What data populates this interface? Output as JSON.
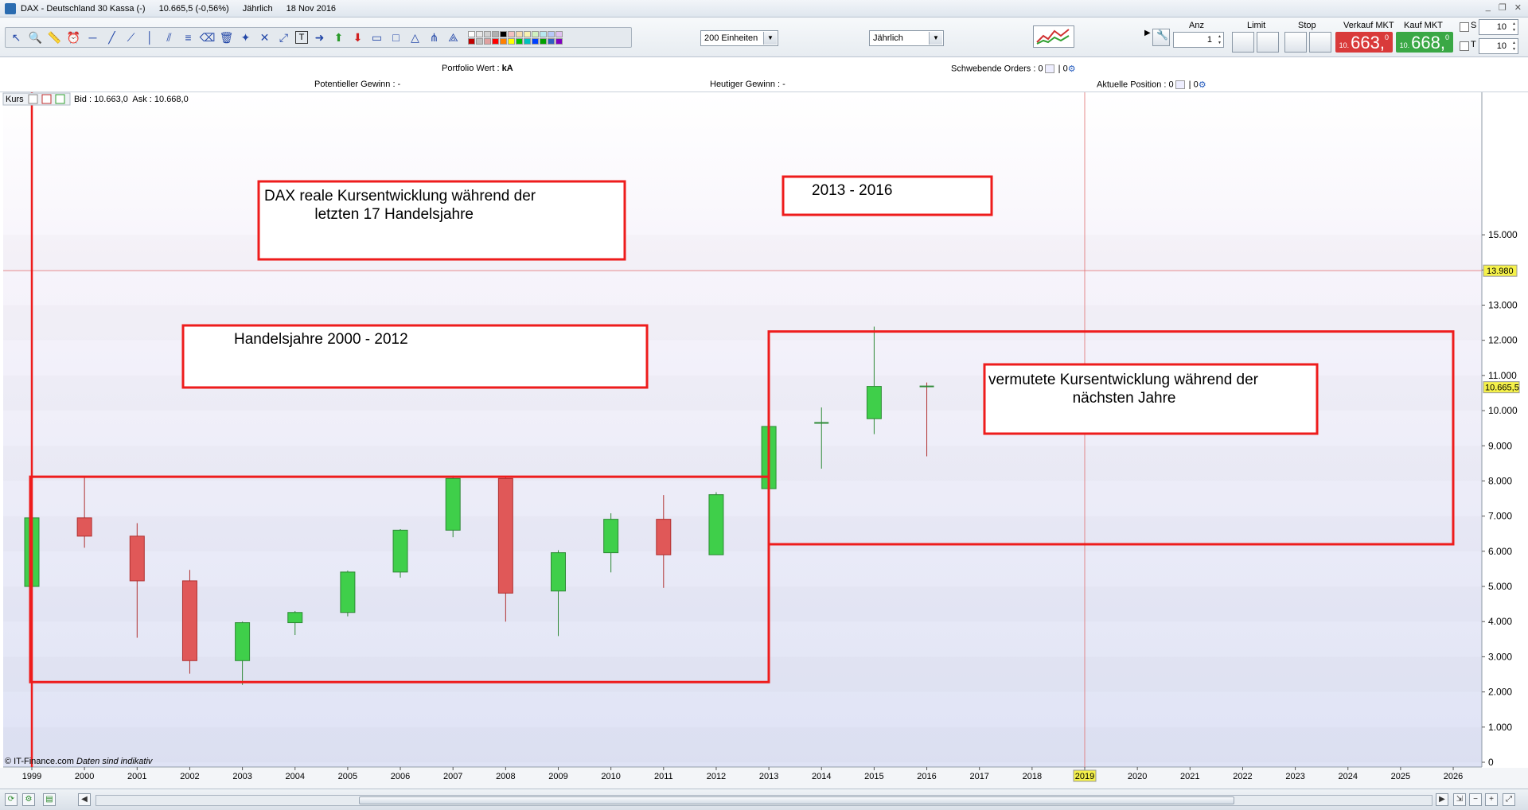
{
  "window": {
    "instrument": "DAX - Deutschland 30 Kassa (-)",
    "quote": "10.665,5 (-0,56%)",
    "period": "Jährlich",
    "date": "18 Nov 2016"
  },
  "toolbar": {
    "units_select": "200 Einheiten",
    "interval_select": "Jährlich",
    "tool_icons": [
      "cursor-icon",
      "zoom-icon",
      "ruler-icon",
      "alarm-icon",
      "hline-icon",
      "trendline-icon",
      "ray-icon",
      "vline-icon",
      "channel-icon",
      "fibonacci-icon",
      "eraser-icon",
      "delete-icon",
      "magic-icon",
      "cross-icon",
      "extend-icon",
      "text-icon",
      "arrow-right-icon",
      "arrow-up-icon",
      "arrow-down-icon",
      "rectangle-icon",
      "rectangle-outline-icon",
      "triangle-icon",
      "pitchfork-icon",
      "gann-icon"
    ],
    "palette": [
      "#ffffff",
      "#e8e8e8",
      "#d0d0d0",
      "#b0b0b0",
      "#000000",
      "#f4c0c0",
      "#f7dcb0",
      "#f8f2b0",
      "#d0f0c0",
      "#b8e8f0",
      "#b8c8f8",
      "#e0c0f0",
      "#c00000",
      "#c0c0c0",
      "#e0a0a0",
      "#ff0000",
      "#ff8000",
      "#ffff00",
      "#00c000",
      "#00c0c0",
      "#0040ff",
      "#00a000",
      "#3060c0",
      "#8000c0"
    ]
  },
  "order": {
    "anz_label": "Anz",
    "anz_value": "1",
    "limit_label": "Limit",
    "stop_label": "Stop",
    "sell_label": "Verkauf MKT",
    "buy_label": "Kauf MKT",
    "sell_prefix": "10.",
    "sell_big": "663,",
    "sell_sup": "0",
    "buy_prefix": "10.",
    "buy_big": "668,",
    "buy_sup": "0",
    "s_label": "S",
    "t_label": "T",
    "s_value": "10",
    "t_value": "10",
    "sell_color": "#d93a3a",
    "buy_color": "#3aa845"
  },
  "info": {
    "portfolio_label": "Portfolio Wert :",
    "portfolio_value": "kA",
    "pending_label": "Schwebende Orders :",
    "pending_a": "0",
    "pending_b": "0",
    "pot_gain": "Potentieller Gewinn : -",
    "today_gain": "Heutiger Gewinn : -",
    "position_label": "Aktuelle Position :",
    "position_a": "0",
    "position_b": "0"
  },
  "chart_data": {
    "type": "candlestick",
    "title": "",
    "legend_label": "Kurs",
    "bid_ask": "Bid : 10.663,0  Ask : 10.668,0",
    "footer": "© IT-Finance.com",
    "footer_note": "Daten sind indikativ",
    "ylim": [
      0,
      15500
    ],
    "y_ticks": [
      0,
      1000,
      2000,
      3000,
      4000,
      5000,
      6000,
      7000,
      8000,
      9000,
      10000,
      11000,
      12000,
      13000,
      14000,
      15000
    ],
    "y_tick_labels": [
      "0",
      "1.000",
      "2.000",
      "3.000",
      "4.000",
      "5.000",
      "6.000",
      "7.000",
      "8.000",
      "9.000",
      "10.000",
      "11.000",
      "12.000",
      "13.000",
      "14.000",
      "15.000"
    ],
    "x_labels": [
      "1999",
      "2000",
      "2001",
      "2002",
      "2003",
      "2004",
      "2005",
      "2006",
      "2007",
      "2008",
      "2009",
      "2010",
      "2011",
      "2012",
      "2013",
      "2014",
      "2015",
      "2016",
      "2017",
      "2018",
      "2019",
      "2020",
      "2021",
      "2022",
      "2023",
      "2024",
      "2025",
      "2026"
    ],
    "highlight_x": "2019",
    "crosshair_price": 13980,
    "crosshair_label": "13.980",
    "last_price": 10665.5,
    "last_label": "10.665,5",
    "candles": [
      {
        "year": "1999",
        "o": 5000,
        "h": 6950,
        "l": 5000,
        "c": 6950
      },
      {
        "year": "2000",
        "o": 6950,
        "h": 8100,
        "l": 6100,
        "c": 6430
      },
      {
        "year": "2001",
        "o": 6430,
        "h": 6800,
        "l": 3540,
        "c": 5160
      },
      {
        "year": "2002",
        "o": 5160,
        "h": 5470,
        "l": 2520,
        "c": 2890
      },
      {
        "year": "2003",
        "o": 2890,
        "h": 4000,
        "l": 2200,
        "c": 3970
      },
      {
        "year": "2004",
        "o": 3970,
        "h": 4300,
        "l": 3620,
        "c": 4260
      },
      {
        "year": "2005",
        "o": 4260,
        "h": 5450,
        "l": 4150,
        "c": 5410
      },
      {
        "year": "2006",
        "o": 5410,
        "h": 6630,
        "l": 5250,
        "c": 6600
      },
      {
        "year": "2007",
        "o": 6600,
        "h": 8150,
        "l": 6400,
        "c": 8070
      },
      {
        "year": "2008",
        "o": 8070,
        "h": 8120,
        "l": 4000,
        "c": 4810
      },
      {
        "year": "2009",
        "o": 4870,
        "h": 6030,
        "l": 3590,
        "c": 5960
      },
      {
        "year": "2010",
        "o": 5960,
        "h": 7080,
        "l": 5400,
        "c": 6910
      },
      {
        "year": "2011",
        "o": 6910,
        "h": 7600,
        "l": 4960,
        "c": 5900
      },
      {
        "year": "2012",
        "o": 5900,
        "h": 7680,
        "l": 5900,
        "c": 7610
      },
      {
        "year": "2013",
        "o": 7780,
        "h": 9620,
        "l": 7650,
        "c": 9550
      },
      {
        "year": "2014",
        "o": 9600,
        "h": 10090,
        "l": 8350,
        "c": 9650
      },
      {
        "year": "2015",
        "o": 9770,
        "h": 12390,
        "l": 9330,
        "c": 10690
      },
      {
        "year": "2016",
        "o": 10690,
        "h": 10800,
        "l": 8700,
        "c": 10665
      }
    ],
    "annotations": [
      {
        "text": "DAX reale Kursentwicklung während der\n            letzten 17 Handelsjahre"
      },
      {
        "text": "Handelsjahre 2000 - 2012"
      },
      {
        "text": "2013 - 2016"
      },
      {
        "text": "vermutete Kursentwicklung während der\n                    nächsten Jahre"
      }
    ],
    "up_color": "#3fcf4a",
    "down_color": "#e05858",
    "annotation_color": "#ee1c1c"
  }
}
